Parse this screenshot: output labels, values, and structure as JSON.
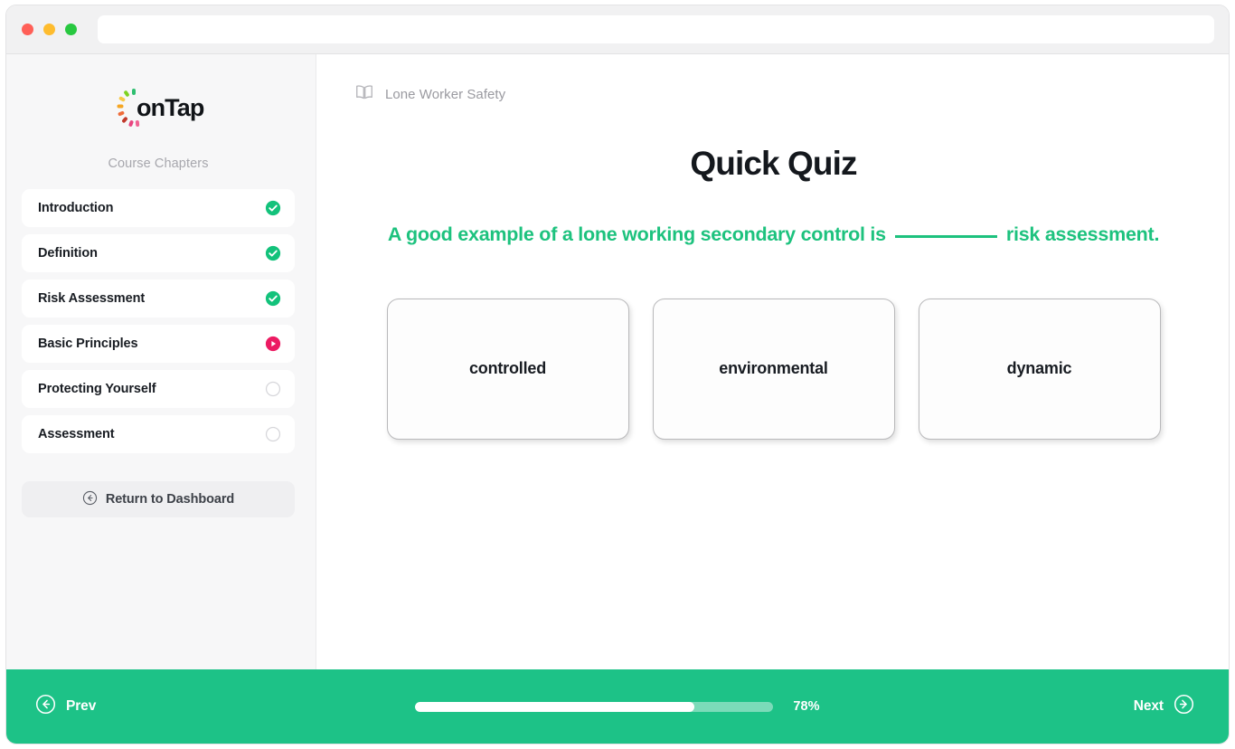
{
  "browser": {
    "url_value": "",
    "url_placeholder": "",
    "traffic_lights": [
      "close-red",
      "minimize-yellow",
      "maximize-green"
    ]
  },
  "sidebar": {
    "logo_text": "onTap",
    "logo_spark_colors": [
      "#f5a623",
      "#f7c948",
      "#7ed321",
      "#2fbf71",
      "#e8447f",
      "#c0392b",
      "#f06292",
      "#ef6c3a"
    ],
    "chapters_heading": "Course Chapters",
    "chapters": [
      {
        "label": "Introduction",
        "status": "complete"
      },
      {
        "label": "Definition",
        "status": "complete"
      },
      {
        "label": "Risk Assessment",
        "status": "complete"
      },
      {
        "label": "Basic Principles",
        "status": "current"
      },
      {
        "label": "Protecting Yourself",
        "status": "locked"
      },
      {
        "label": "Assessment",
        "status": "locked"
      }
    ],
    "return_label": "Return to Dashboard"
  },
  "main": {
    "breadcrumb_course": "Lone Worker Safety",
    "quiz_title": "Quick Quiz",
    "question_before": "A good example of a lone working secondary control is",
    "question_after": "risk assessment.",
    "options": [
      {
        "label": "controlled"
      },
      {
        "label": "environmental"
      },
      {
        "label": "dynamic"
      }
    ]
  },
  "footer": {
    "prev_label": "Prev",
    "next_label": "Next",
    "progress_percent": 78,
    "progress_text": "78%"
  },
  "colors": {
    "accent_green": "#1dc287",
    "question_green": "#1dc27e",
    "current_pink": "#ec1b62",
    "sidebar_bg": "#f7f7f8",
    "text_dark": "#181c22",
    "text_muted": "#9a9aa0"
  }
}
